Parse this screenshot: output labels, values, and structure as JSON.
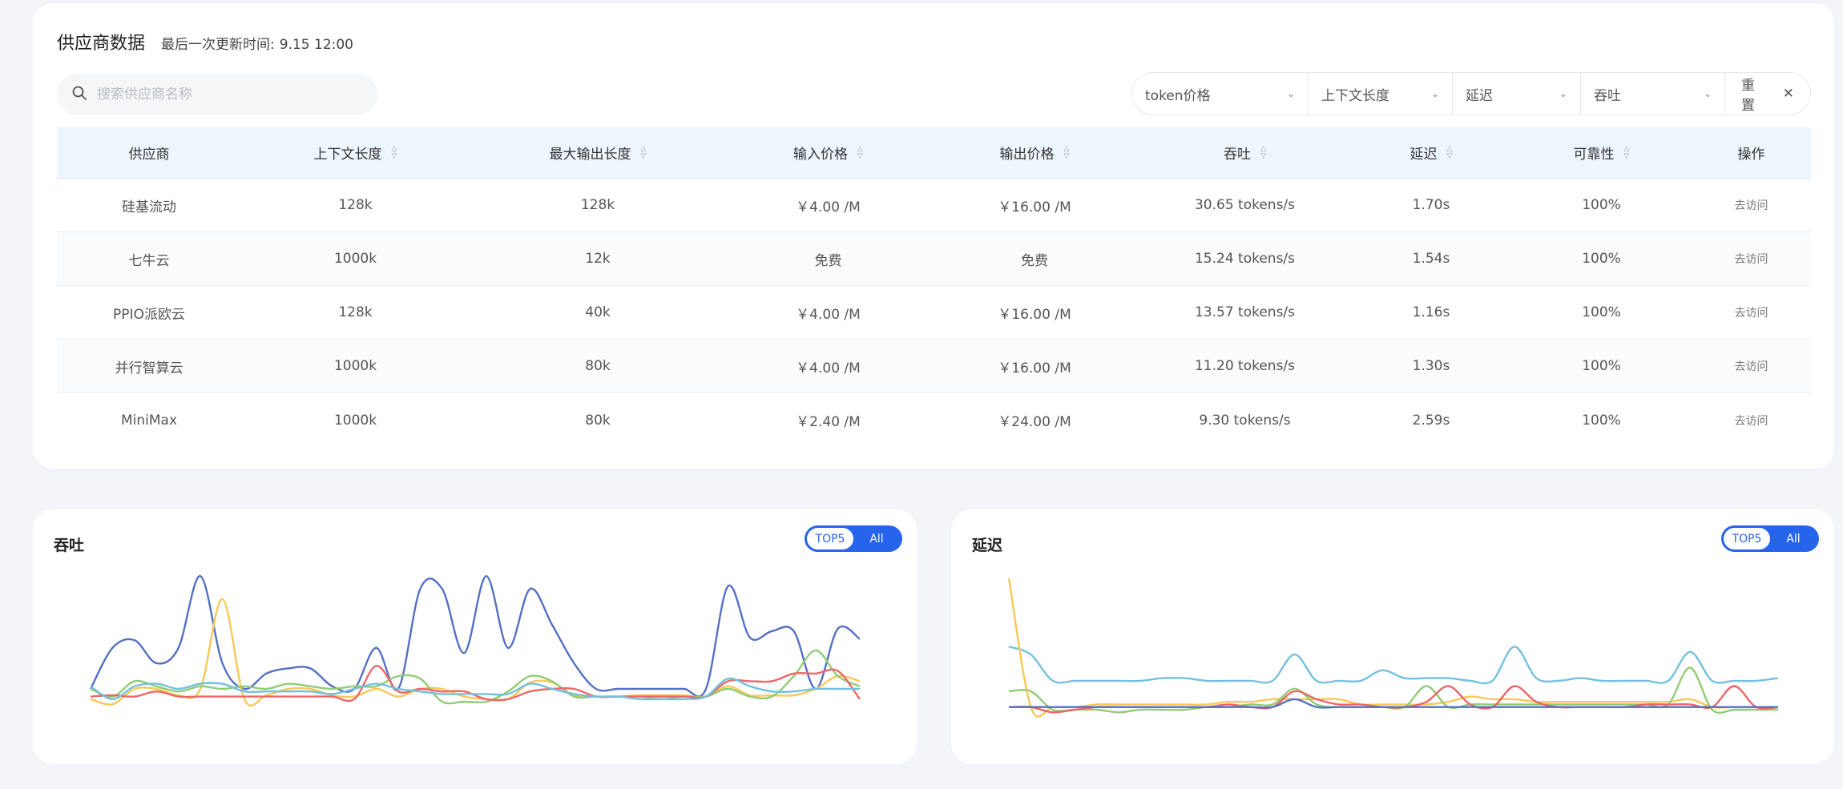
{
  "header": {
    "title": "供应商数据",
    "updated_label": "最后一次更新时间:",
    "updated_value": "9.15 12:00"
  },
  "search": {
    "placeholder": "搜索供应商名称"
  },
  "filters": {
    "token_price": "token价格",
    "context": "上下文长度",
    "latency": "延迟",
    "throughput": "吞吐",
    "reset": "重置"
  },
  "table": {
    "columns": [
      "供应商",
      "上下文长度",
      "最大输出长度",
      "输入价格",
      "输出价格",
      "吞吐",
      "延迟",
      "可靠性",
      "操作"
    ],
    "rows": [
      [
        "硅基流动",
        "128k",
        "128k",
        "￥4.00 /M",
        "￥16.00 /M",
        "30.65 tokens/s",
        "1.70s",
        "100%",
        "去访问"
      ],
      [
        "七牛云",
        "1000k",
        "12k",
        "免费",
        "免费",
        "15.24 tokens/s",
        "1.54s",
        "100%",
        "去访问"
      ],
      [
        "PPIO派欧云",
        "128k",
        "40k",
        "￥4.00 /M",
        "￥16.00 /M",
        "13.57 tokens/s",
        "1.16s",
        "100%",
        "去访问"
      ],
      [
        "并行智算云",
        "1000k",
        "80k",
        "￥4.00 /M",
        "￥16.00 /M",
        "11.20 tokens/s",
        "1.30s",
        "100%",
        "去访问"
      ],
      [
        "MiniMax",
        "1000k",
        "80k",
        "￥2.40 /M",
        "￥24.00 /M",
        "9.30 tokens/s",
        "2.59s",
        "100%",
        "去访问"
      ]
    ]
  },
  "throughput_panel": {
    "title": "吞吐",
    "toggle": [
      "TOP5",
      "All"
    ],
    "active": "TOP5"
  },
  "latency_panel": {
    "title": "延迟",
    "toggle": [
      "TOP5",
      "All"
    ],
    "active": "TOP5"
  },
  "colors": {
    "accent": "#2564eb",
    "blue": "#5470c6",
    "yellow": "#fac858",
    "green": "#91cc75",
    "red": "#ee6666",
    "cyan": "#73c0de"
  },
  "chart_data": [
    {
      "type": "line",
      "title": "吞吐",
      "ylim": [
        0,
        100
      ],
      "series": [
        {
          "color": "#5470c6",
          "values": [
            10,
            42,
            48,
            30,
            42,
            98,
            30,
            10,
            22,
            26,
            26,
            12,
            10,
            42,
            10,
            88,
            88,
            38,
            98,
            42,
            88,
            60,
            30,
            10,
            10,
            10,
            10,
            10,
            10,
            90,
            50,
            55,
            55,
            10,
            57,
            49
          ]
        },
        {
          "color": "#fac858",
          "values": [
            2,
            -2,
            10,
            10,
            5,
            10,
            80,
            2,
            5,
            10,
            10,
            5,
            4,
            10,
            4,
            10,
            10,
            4,
            2,
            2,
            15,
            15,
            5,
            4,
            4,
            5,
            5,
            5,
            4,
            12,
            5,
            5,
            5,
            10,
            20,
            16
          ]
        },
        {
          "color": "#91cc75",
          "values": [
            10,
            4,
            16,
            12,
            8,
            12,
            10,
            12,
            10,
            14,
            12,
            10,
            12,
            12,
            20,
            18,
            0,
            0,
            0,
            8,
            20,
            16,
            4,
            4,
            4,
            4,
            2,
            4,
            4,
            10,
            4,
            4,
            20,
            40,
            20,
            12
          ]
        },
        {
          "color": "#ee6666",
          "values": [
            4,
            5,
            4,
            8,
            4,
            4,
            4,
            4,
            4,
            4,
            4,
            4,
            2,
            28,
            8,
            10,
            8,
            8,
            2,
            2,
            8,
            10,
            10,
            4,
            4,
            4,
            4,
            4,
            4,
            16,
            16,
            16,
            22,
            22,
            24,
            2
          ]
        },
        {
          "color": "#73c0de",
          "values": [
            12,
            2,
            12,
            14,
            10,
            14,
            14,
            8,
            8,
            8,
            8,
            6,
            10,
            14,
            10,
            8,
            6,
            6,
            6,
            6,
            14,
            10,
            6,
            4,
            4,
            2,
            2,
            2,
            4,
            18,
            12,
            8,
            8,
            10,
            10,
            10
          ]
        }
      ]
    },
    {
      "type": "line",
      "title": "延迟",
      "ylim": [
        0,
        100
      ],
      "series": [
        {
          "color": "#73c0de",
          "values": [
            48,
            42,
            22,
            22,
            22,
            22,
            22,
            24,
            24,
            22,
            22,
            22,
            22,
            42,
            22,
            22,
            22,
            30,
            24,
            24,
            24,
            22,
            22,
            48,
            24,
            22,
            24,
            22,
            22,
            22,
            22,
            44,
            22,
            22,
            22,
            24
          ]
        },
        {
          "color": "#fac858",
          "values": [
            100,
            2,
            2,
            2,
            4,
            4,
            4,
            4,
            4,
            4,
            6,
            6,
            8,
            8,
            8,
            8,
            4,
            4,
            4,
            4,
            6,
            10,
            8,
            8,
            6,
            6,
            6,
            6,
            6,
            6,
            6,
            8,
            2,
            2,
            2,
            2
          ]
        },
        {
          "color": "#91cc75",
          "values": [
            14,
            14,
            0,
            0,
            0,
            -2,
            0,
            0,
            0,
            2,
            2,
            4,
            4,
            16,
            4,
            2,
            2,
            2,
            2,
            18,
            2,
            4,
            4,
            4,
            4,
            4,
            4,
            4,
            4,
            4,
            4,
            32,
            0,
            0,
            0,
            0
          ]
        },
        {
          "color": "#ee6666",
          "values": [
            2,
            2,
            -2,
            0,
            2,
            2,
            2,
            2,
            2,
            2,
            4,
            2,
            2,
            14,
            8,
            4,
            4,
            2,
            2,
            6,
            18,
            4,
            2,
            18,
            6,
            2,
            2,
            2,
            2,
            4,
            4,
            4,
            2,
            18,
            2,
            2
          ]
        },
        {
          "color": "#5470c6",
          "values": [
            2,
            2,
            2,
            2,
            2,
            2,
            2,
            2,
            2,
            2,
            2,
            2,
            2,
            8,
            2,
            2,
            2,
            2,
            2,
            2,
            2,
            2,
            2,
            2,
            2,
            2,
            2,
            2,
            2,
            2,
            2,
            2,
            2,
            2,
            2,
            2
          ]
        }
      ]
    }
  ]
}
